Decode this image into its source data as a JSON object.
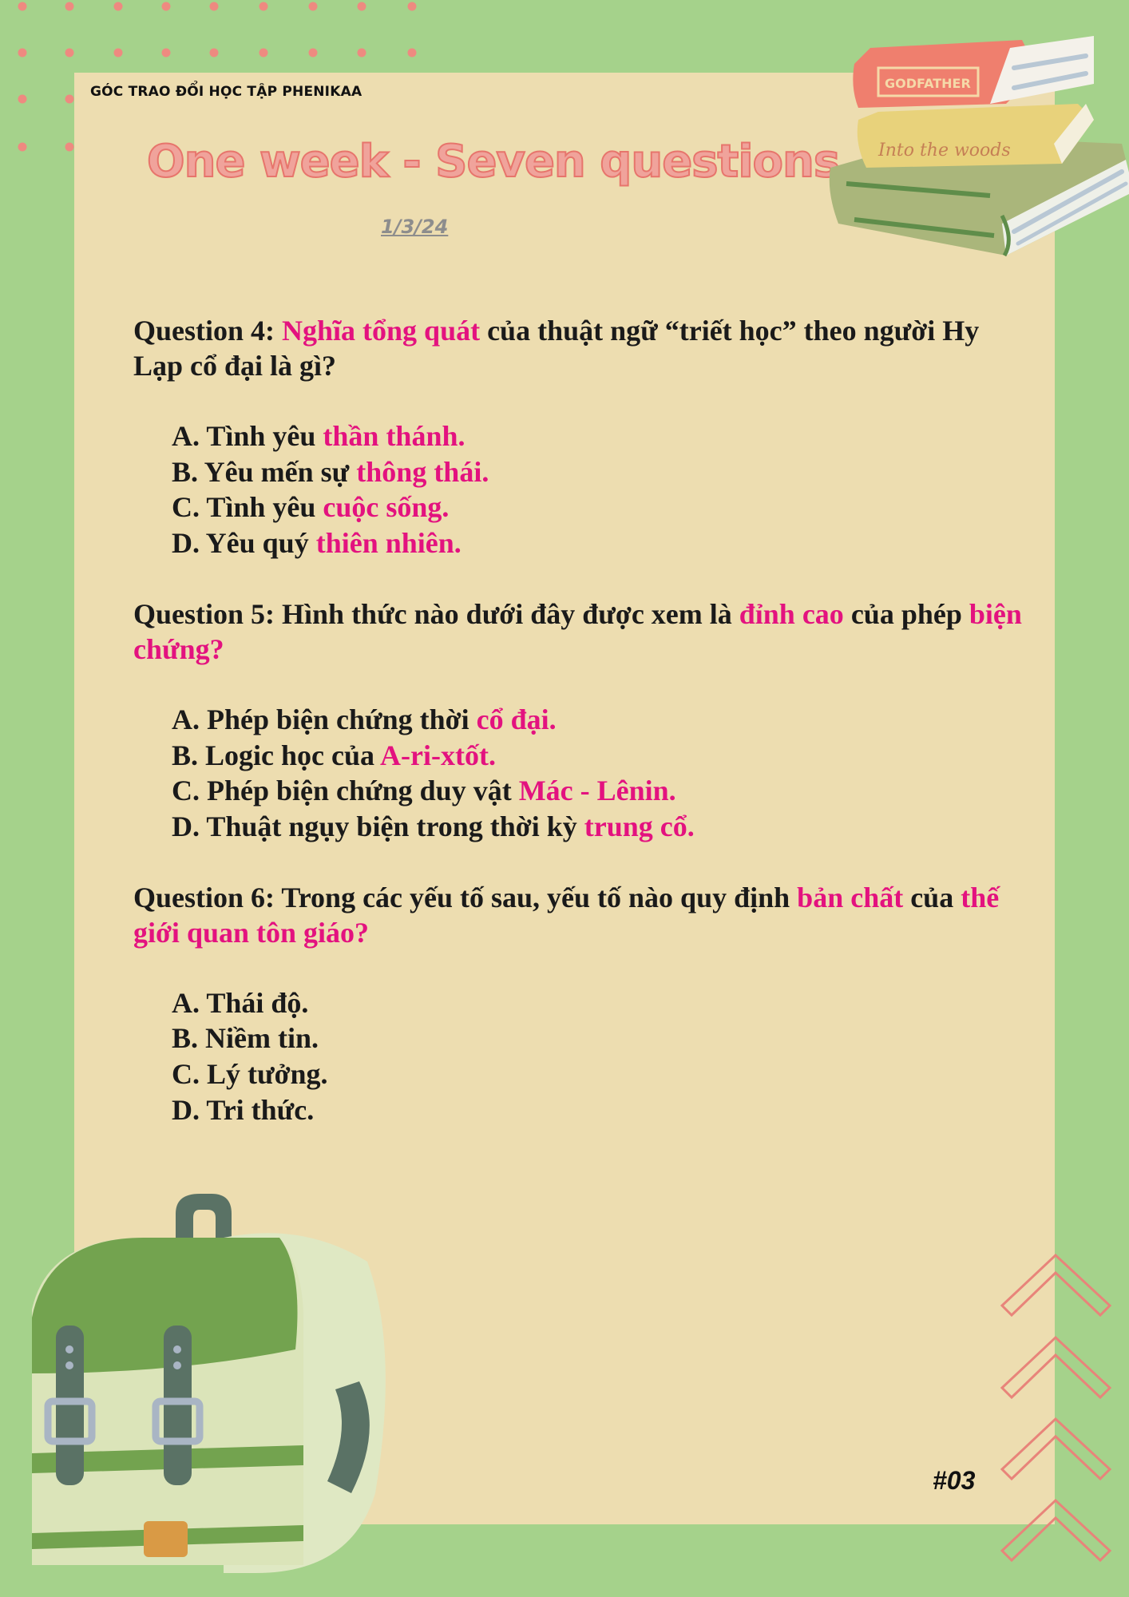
{
  "header": {
    "org_label": "GÓC TRAO ĐỔI HỌC TẬP PHENIKAA",
    "title": "One week  - Seven questions",
    "date": "1/3/24"
  },
  "colors": {
    "background_green": "#a5d28b",
    "paper": "#edddb0",
    "highlight": "#e3127f",
    "title_fill": "#f0a39b",
    "title_stroke": "#e7756c"
  },
  "questions": [
    {
      "prefix": "Question 4: ",
      "parts": [
        {
          "text": "Nghĩa tổng quát",
          "hl": true
        },
        {
          "text": " của thuật ngữ “triết học” theo người Hy Lạp cổ đại là gì?",
          "hl": false
        }
      ],
      "options": [
        [
          {
            "text": "A. Tình yêu ",
            "hl": false
          },
          {
            "text": "thần thánh.",
            "hl": true
          }
        ],
        [
          {
            "text": "B. Yêu mến sự ",
            "hl": false
          },
          {
            "text": "thông thái.",
            "hl": true
          }
        ],
        [
          {
            "text": "C. Tình yêu ",
            "hl": false
          },
          {
            "text": "cuộc sống.",
            "hl": true
          }
        ],
        [
          {
            "text": "D. Yêu quý ",
            "hl": false
          },
          {
            "text": "thiên nhiên.",
            "hl": true
          }
        ]
      ]
    },
    {
      "prefix": "Question 5: ",
      "parts": [
        {
          "text": "Hình thức nào dưới đây được xem là ",
          "hl": false
        },
        {
          "text": "đỉnh cao",
          "hl": true
        },
        {
          "text": " của phép ",
          "hl": false
        },
        {
          "text": "biện chứng?",
          "hl": true
        }
      ],
      "options": [
        [
          {
            "text": "A. Phép biện chứng thời ",
            "hl": false
          },
          {
            "text": "cổ đại.",
            "hl": true
          }
        ],
        [
          {
            "text": "B. Logic học của ",
            "hl": false
          },
          {
            "text": "A-ri-xtốt.",
            "hl": true
          }
        ],
        [
          {
            "text": "C. Phép biện chứng duy vật ",
            "hl": false
          },
          {
            "text": "Mác - Lênin.",
            "hl": true
          }
        ],
        [
          {
            "text": "D. Thuật ngụy biện trong thời kỳ ",
            "hl": false
          },
          {
            "text": "trung cổ.",
            "hl": true
          }
        ]
      ]
    },
    {
      "prefix": "Question 6: ",
      "parts": [
        {
          "text": "Trong các yếu tố sau, yếu tố nào quy định ",
          "hl": false
        },
        {
          "text": "bản chất",
          "hl": true
        },
        {
          "text": " của ",
          "hl": false
        },
        {
          "text": "thế giới quan tôn giáo?",
          "hl": true
        }
      ],
      "options": [
        [
          {
            "text": "A. Thái độ.",
            "hl": false
          }
        ],
        [
          {
            "text": "B. Niềm tin.",
            "hl": false
          }
        ],
        [
          {
            "text": "C. Lý tưởng.",
            "hl": false
          }
        ],
        [
          {
            "text": "D. Tri thức.",
            "hl": false
          }
        ]
      ]
    }
  ],
  "decor": {
    "book_titles": [
      "GODFATHER",
      "Into the woods"
    ],
    "icons": [
      "books-illustration",
      "backpack-illustration",
      "chevron-up-icon"
    ]
  },
  "footer": {
    "page_number": "#03"
  }
}
